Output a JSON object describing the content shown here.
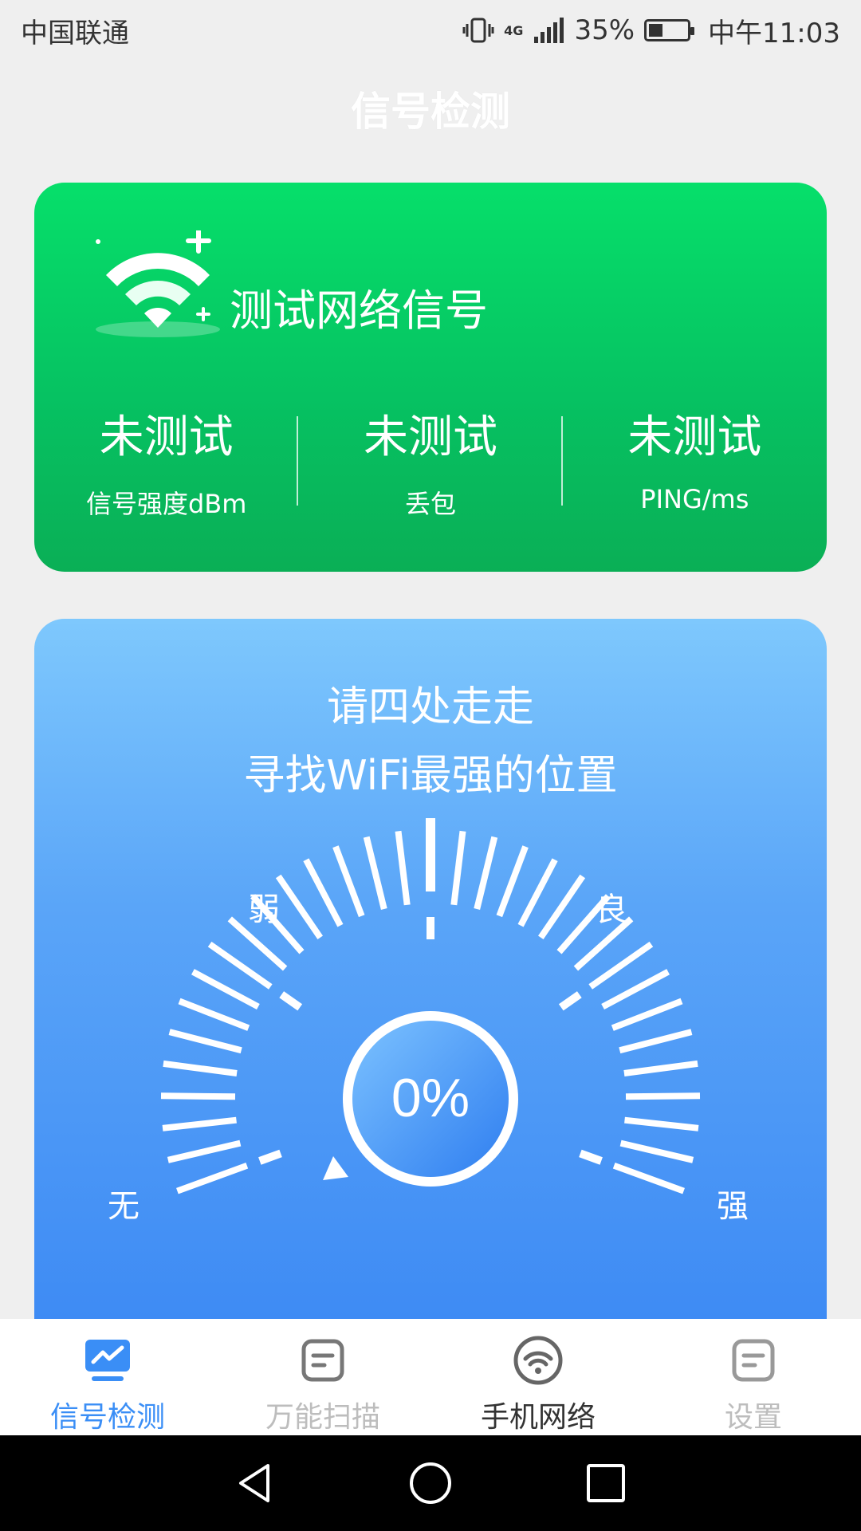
{
  "status_bar": {
    "carrier": "中国联通",
    "network": "4G",
    "battery": "35%",
    "time": "中午11:03",
    "battery_level": 0.35
  },
  "page_title": "信号检测",
  "green_card": {
    "title": "测试网络信号",
    "stats": [
      {
        "value": "未测试",
        "label": "信号强度dBm"
      },
      {
        "value": "未测试",
        "label": "丢包"
      },
      {
        "value": "未测试",
        "label": "PING/ms"
      }
    ]
  },
  "blue_card": {
    "hint_line1": "请四处走走",
    "hint_line2": "寻找WiFi最强的位置",
    "gauge": {
      "value_text": "0%",
      "value": 0,
      "labels": {
        "none": "无",
        "weak": "弱",
        "good": "良",
        "strong": "强"
      }
    }
  },
  "bottom_nav": [
    {
      "label": "信号检测",
      "icon": "chart-icon",
      "active": true
    },
    {
      "label": "万能扫描",
      "icon": "document-icon",
      "active": false
    },
    {
      "label": "手机网络",
      "icon": "wifi-icon",
      "active": false
    },
    {
      "label": "设置",
      "icon": "document-icon",
      "active": false
    }
  ],
  "colors": {
    "green_top": "#06df6a",
    "green_bottom": "#0aaf56",
    "blue_top": "#7ec8fd",
    "blue_bottom": "#3d8af4",
    "nav_active": "#3a8ef6",
    "nav_inactive": "#bdbdbd",
    "nav_dark": "#333333"
  }
}
